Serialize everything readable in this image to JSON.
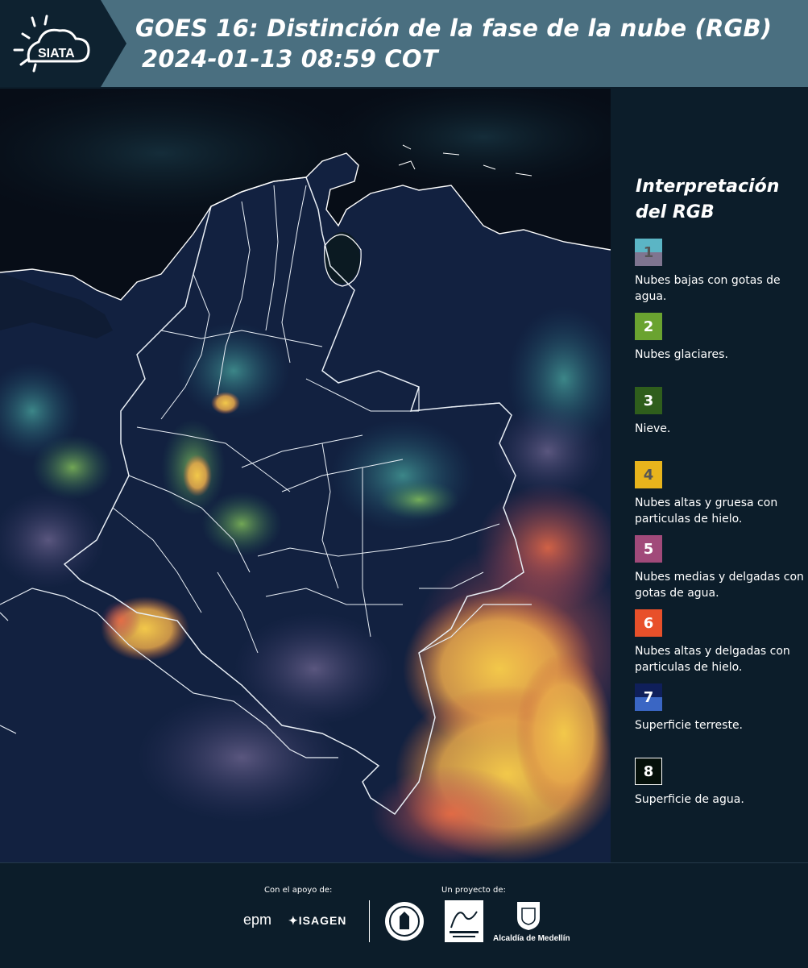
{
  "header": {
    "brand": "SIATA",
    "title_line1": "GOES 16: Distinción de la fase de la nube (RGB)",
    "title_line2": "2024-01-13 08:59 COT"
  },
  "legend": {
    "title_line1": "Interpretación",
    "title_line2": "del RGB",
    "items": [
      {
        "number": "1",
        "label": "Nubes bajas con gotas de agua.",
        "color_top": "#5bb5c5",
        "color_bottom": "#7f7590",
        "text_color": "#555555"
      },
      {
        "number": "2",
        "label": "Nubes glaciares.",
        "color_top": "#6aa330",
        "color_bottom": "#6aa330",
        "text_color": "#ffffff"
      },
      {
        "number": "3",
        "label": "Nieve.",
        "color_top": "#2f5e1c",
        "color_bottom": "#2f5e1c",
        "text_color": "#ffffff"
      },
      {
        "number": "4",
        "label": "Nubes altas y gruesa con particulas de hielo.",
        "color_top": "#e8b41c",
        "color_bottom": "#e8b41c",
        "text_color": "#555555"
      },
      {
        "number": "5",
        "label": "Nubes medias y delgadas con gotas de agua.",
        "color_top": "#a14a7a",
        "color_bottom": "#a14a7a",
        "text_color": "#ffffff"
      },
      {
        "number": "6",
        "label": "Nubes altas y delgadas con particulas de hielo.",
        "color_top": "#e8502a",
        "color_bottom": "#e8502a",
        "text_color": "#ffffff"
      },
      {
        "number": "7",
        "label": "Superficie terreste.",
        "color_top": "#0f1f5a",
        "color_bottom": "#3a66c4",
        "text_color": "#ffffff"
      },
      {
        "number": "8",
        "label": "Superficie de agua.",
        "color_top": "#05100a",
        "color_bottom": "#05100a",
        "text_color": "#ffffff"
      }
    ]
  },
  "footer": {
    "support_label": "Con el apoyo de:",
    "project_label": "Un proyecto de:",
    "sponsor_1": "epm",
    "sponsor_2": "ISAGEN",
    "partner_3": "Alcaldía de Medellín"
  },
  "colors": {
    "header_bg": "#4a6f80",
    "page_bg": "#0c1d2a",
    "ocean": "#070d17",
    "land": "#122140"
  }
}
